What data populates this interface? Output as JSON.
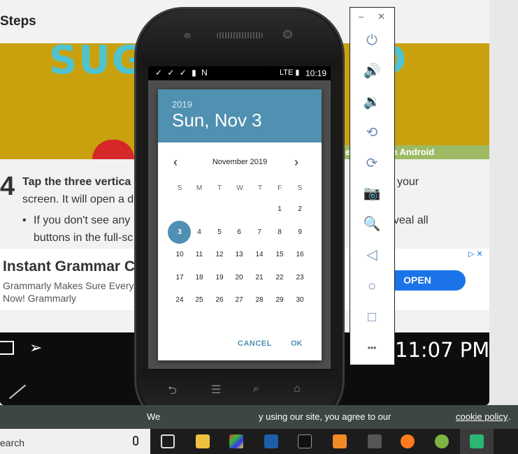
{
  "article": {
    "section_title": "Steps",
    "hero_text": "SUG",
    "hero_text_right": "D",
    "hero_caption": "e Photos on Android",
    "step_number": "4",
    "step_bold": "Tap the three vertica",
    "step_line1_end": "your",
    "step_line2": "screen. It will open a d",
    "bullet_start": "If you don't see any",
    "bullet_end": "eveal all",
    "bullet_line2": "buttons in the full-sc"
  },
  "ad": {
    "title": "Instant Grammar C",
    "body": "Grammarly Makes Sure Everyt Now! Grammarly",
    "cta": "OPEN",
    "adchoices": "▷ ✕"
  },
  "video_bar": {
    "clock": "11:07 PM"
  },
  "cookie_bar": {
    "text_left": "We",
    "text": "y using our site, you agree to our",
    "link": "cookie policy",
    "suffix": "."
  },
  "taskbar": {
    "search": "earch"
  },
  "phone": {
    "status": {
      "time": "10:19",
      "left_icons": "✓ ✓ ✓ ▮ N",
      "right_icons": "LTE ▮"
    },
    "date_picker": {
      "year": "2019",
      "date": "Sun, Nov 3",
      "month": "November 2019",
      "prev": "‹",
      "next": "›",
      "weekdays": [
        "S",
        "M",
        "T",
        "W",
        "T",
        "F",
        "S"
      ],
      "days": [
        "1",
        "2",
        "3",
        "4",
        "5",
        "6",
        "7",
        "8",
        "9",
        "10",
        "11",
        "12",
        "13",
        "14",
        "15",
        "16",
        "17",
        "18",
        "19",
        "20",
        "21",
        "22",
        "23",
        "24",
        "25",
        "26",
        "27",
        "28",
        "29",
        "30"
      ],
      "selected_day": "3",
      "cancel": "CANCEL",
      "ok": "OK"
    },
    "nav_keys": {
      "back": "⮌",
      "menu": "☰",
      "search": "⌕",
      "home": "⌂"
    }
  },
  "emulator_toolbar": {
    "minimize": "–",
    "close": "✕",
    "tools": [
      {
        "name": "power-icon",
        "glyph": "⏻"
      },
      {
        "name": "volume-up-icon",
        "glyph": "🔊"
      },
      {
        "name": "volume-down-icon",
        "glyph": "🔉"
      },
      {
        "name": "rotate-left-icon",
        "glyph": "⟲"
      },
      {
        "name": "rotate-right-icon",
        "glyph": "⟳"
      },
      {
        "name": "camera-icon",
        "glyph": "📷"
      },
      {
        "name": "zoom-icon",
        "glyph": "🔍"
      },
      {
        "name": "back-icon",
        "glyph": "◁"
      },
      {
        "name": "home-icon",
        "glyph": "○"
      },
      {
        "name": "overview-icon",
        "glyph": "□"
      },
      {
        "name": "more-icon",
        "glyph": "•••"
      }
    ]
  },
  "colors": {
    "accent": "#4f8fb3",
    "dialog_header": "#5090b0",
    "open_button": "#1a73e8",
    "cookie_bar": "#3d4642"
  }
}
